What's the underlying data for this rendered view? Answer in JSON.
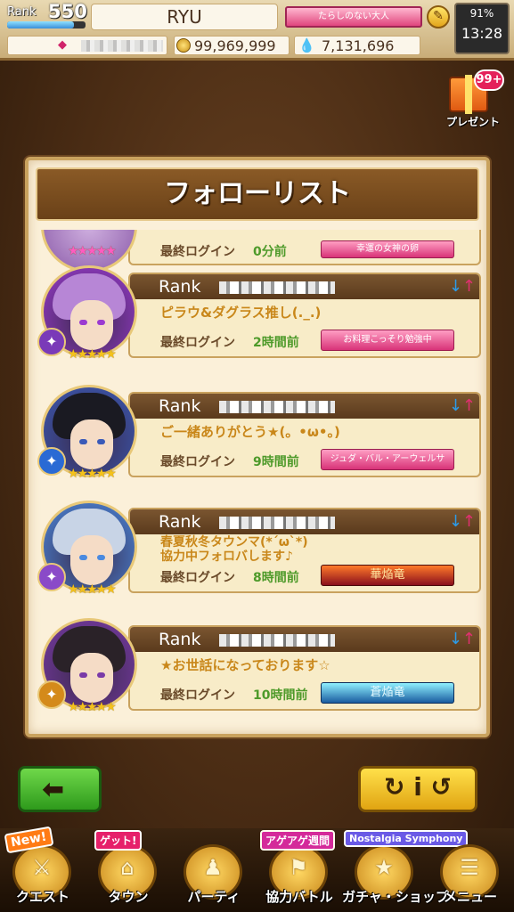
{
  "status": {
    "rank_label": "Rank",
    "rank_value": "550",
    "xp_fraction": 0.85,
    "player_name": "RYU",
    "player_title": "たらしのない大人",
    "coins": "99,969,999",
    "drops": "7,131,696",
    "battery": "91%",
    "time": "13:28"
  },
  "present": {
    "badge": "99+",
    "label": "プレゼント"
  },
  "panel": {
    "title": "フォローリスト"
  },
  "top_card": {
    "login_label": "最終ログイン",
    "login_value": "0分前",
    "title_badge": "幸運の女神の卵"
  },
  "cards": [
    {
      "rank_label": "Rank",
      "comment": "ピラウ&ダグラス推し(._.)",
      "login_label": "最終ログイン",
      "login_value": "2時間前",
      "title_badge": "お料理こっそり勉強中",
      "hair_color": "#b786d6",
      "accent": "#9b3ad1",
      "elem_color": "#7a3ab8"
    },
    {
      "rank_label": "Rank",
      "comment": "ご一緒ありがとう★(。•ω•。)",
      "login_label": "最終ログイン",
      "login_value": "9時間前",
      "title_badge": "ジュダ・バル・アーウェルサ",
      "hair_color": "#1a1a22",
      "accent": "#3a5ab8",
      "elem_color": "#2a6ad4"
    },
    {
      "rank_label": "Rank",
      "comment": "春夏秋冬タウンマ(*´ω`*)",
      "comment2": "協力中フォロバします♪",
      "login_label": "最終ログイン",
      "login_value": "8時間前",
      "title_badge": "華焔竜",
      "hair_color": "#c8d4e6",
      "accent": "#4a8ae0",
      "elem_color": "#8a4ac8"
    },
    {
      "rank_label": "Rank",
      "comment": "★お世話になっております☆",
      "login_label": "最終ログイン",
      "login_value": "10時間前",
      "title_badge": "蒼焔竜",
      "hair_color": "#2a2228",
      "accent": "#7a3aa8",
      "elem_color": "#d48a1a"
    }
  ],
  "buttons": {
    "back_glyph": "⬅",
    "info_glyph": "↻ i ↺"
  },
  "nav": [
    {
      "label": "クエスト",
      "tag": "New!",
      "glyph": "⚔"
    },
    {
      "label": "タウン",
      "tag": "ゲット!",
      "glyph": "⌂"
    },
    {
      "label": "パーティ",
      "tag": "",
      "glyph": "♟"
    },
    {
      "label": "協力バトル",
      "tag": "アゲアゲ週間",
      "glyph": "⚑"
    },
    {
      "label": "ガチャ・ショップ",
      "tag": "Nostalgia Symphony",
      "glyph": "★"
    },
    {
      "label": "メニュー",
      "tag": "",
      "glyph": "☰"
    }
  ]
}
